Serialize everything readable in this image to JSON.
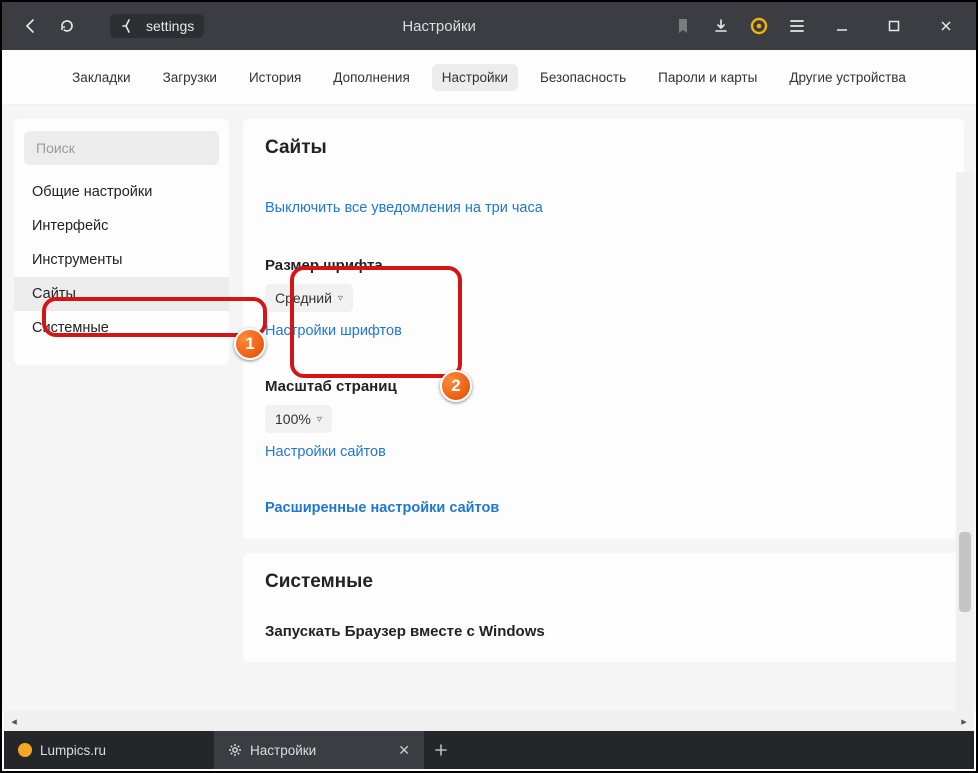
{
  "titlebar": {
    "address_label": "settings",
    "page_title": "Настройки"
  },
  "topnav": {
    "items": [
      "Закладки",
      "Загрузки",
      "История",
      "Дополнения",
      "Настройки",
      "Безопасность",
      "Пароли и карты",
      "Другие устройства"
    ],
    "active_index": 4
  },
  "sidebar": {
    "search_placeholder": "Поиск",
    "items": [
      "Общие настройки",
      "Интерфейс",
      "Инструменты",
      "Сайты",
      "Системные"
    ],
    "selected_index": 3
  },
  "main": {
    "sites_card": {
      "heading": "Сайты",
      "mute_link": "Выключить все уведомления на три часа",
      "font_size_label": "Размер шрифта",
      "font_size_value": "Средний",
      "font_settings_link": "Настройки шрифтов",
      "zoom_label": "Масштаб страниц",
      "zoom_value": "100%",
      "site_settings_link": "Настройки сайтов",
      "advanced_link": "Расширенные настройки сайтов"
    },
    "system_card": {
      "heading": "Системные",
      "autostart_label": "Запускать Браузер вместе с Windows"
    }
  },
  "callouts": {
    "b1": "1",
    "b2": "2"
  },
  "tabs": {
    "items": [
      {
        "label": "Lumpics.ru",
        "active": false
      },
      {
        "label": "Настройки",
        "active": true
      }
    ]
  }
}
